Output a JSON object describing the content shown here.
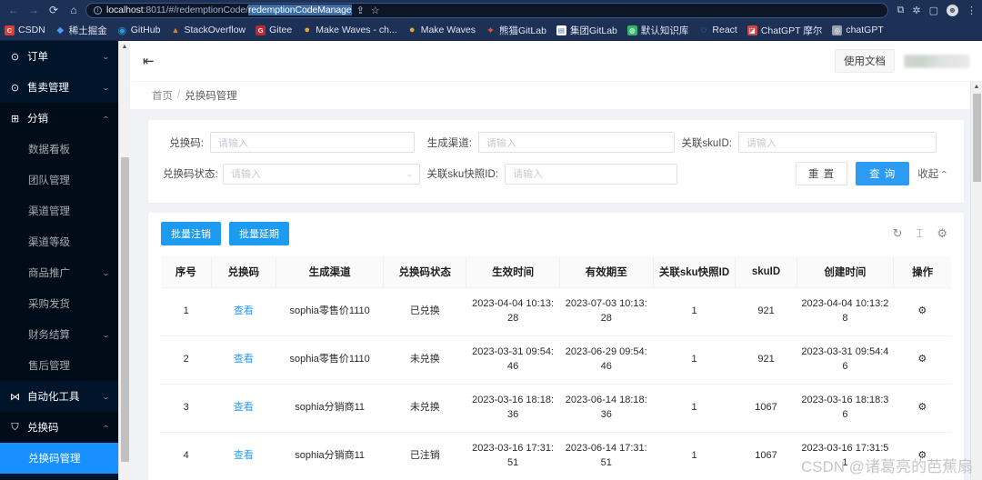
{
  "browser": {
    "nav": {
      "back": "←",
      "forward": "→",
      "reload": "⟳",
      "home": "⌂"
    },
    "url": {
      "scheme_info": "ⓘ",
      "host": "localhost",
      "port": ":8011",
      "path": "/#/redemptionCode/",
      "selected": "redemptionCodeManage"
    },
    "omni_icons": {
      "share": "⇪",
      "star": "☆"
    },
    "toolbar_icons": {
      "tab_group": "⧉",
      "extensions": "✲",
      "sidepanel": "▢",
      "profile": "☻",
      "menu": "⋮"
    },
    "bookmarks": [
      {
        "label": "CSDN",
        "glyph": "C",
        "color": "#e03d2f"
      },
      {
        "label": "稀土掘金",
        "glyph": "◆",
        "color": "#4b9cf6"
      },
      {
        "label": "GitHub",
        "glyph": "◉",
        "color": "#2c9cd6"
      },
      {
        "label": "StackOverflow",
        "glyph": "▲",
        "color": "#e08030"
      },
      {
        "label": "Gitee",
        "glyph": "G",
        "color": "#c6252a"
      },
      {
        "label": "Make Waves - ch...",
        "glyph": "●",
        "color": "#e8a33d"
      },
      {
        "label": "Make Waves",
        "glyph": "●",
        "color": "#e8a33d"
      },
      {
        "label": "熊猫GitLab",
        "glyph": "✦",
        "color": "#e2562a"
      },
      {
        "label": "集团GitLab",
        "glyph": "▤",
        "color": "#ffffff"
      },
      {
        "label": "默认知识库",
        "glyph": "◍",
        "color": "#35b36a"
      },
      {
        "label": "React",
        "glyph": "◌",
        "color": "#35b6c9"
      },
      {
        "label": "ChatGPT 摩尔",
        "glyph": "◪",
        "color": "#c94b4b"
      },
      {
        "label": "chatGPT",
        "glyph": "◎",
        "color": "#9aa3ad"
      }
    ]
  },
  "sidebar": {
    "groups": [
      {
        "icon": "⊙",
        "label": "订单",
        "caret": "⌄",
        "open": false
      },
      {
        "icon": "⊙",
        "label": "售卖管理",
        "caret": "⌄",
        "open": false
      },
      {
        "icon": "⊞",
        "label": "分销",
        "caret": "⌄",
        "open": true,
        "items": [
          {
            "label": "数据看板",
            "caret": "",
            "active": false
          },
          {
            "label": "团队管理",
            "caret": "",
            "active": false
          },
          {
            "label": "渠道管理",
            "caret": "",
            "active": false
          },
          {
            "label": "渠道等级",
            "caret": "",
            "active": false
          },
          {
            "label": "商品推广",
            "caret": "⌄",
            "active": false
          },
          {
            "label": "采购发货",
            "caret": "",
            "active": false
          },
          {
            "label": "财务结算",
            "caret": "⌄",
            "active": false
          },
          {
            "label": "售后管理",
            "caret": "",
            "active": false
          }
        ]
      },
      {
        "icon": "⋈",
        "label": "自动化工具",
        "caret": "⌄",
        "open": false
      },
      {
        "icon": "⛉",
        "label": "兑换码",
        "caret": "⌄",
        "open": true,
        "items": [
          {
            "label": "兑换码管理",
            "caret": "",
            "active": true
          }
        ]
      }
    ]
  },
  "appbar": {
    "menu_toggle": "⇤",
    "doc_button": "使用文档"
  },
  "breadcrumb": {
    "home": "首页",
    "separator": "/",
    "current": "兑换码管理"
  },
  "search_form": {
    "fields": [
      {
        "label": "兑换码:",
        "placeholder": "请输入",
        "value": "",
        "type": "input"
      },
      {
        "label": "生成渠道:",
        "placeholder": "请输入",
        "value": "",
        "type": "input"
      },
      {
        "label": "关联skuID:",
        "placeholder": "请输入",
        "value": "",
        "type": "input"
      },
      {
        "label": "兑换码状态:",
        "placeholder": "请输入",
        "value": "",
        "type": "select"
      },
      {
        "label": "关联sku快照ID:",
        "placeholder": "请输入",
        "value": "",
        "type": "input"
      }
    ],
    "reset_label": "重 置",
    "query_label": "查 询",
    "collapse_label": "收起",
    "collapse_caret": "⌃"
  },
  "table_toolbar": {
    "batch_cancel": "批量注销",
    "batch_extend": "批量延期",
    "icons": {
      "refresh": "↻",
      "density": "⌶",
      "settings": "⚙"
    }
  },
  "table": {
    "columns": [
      "序号",
      "兑换码",
      "生成渠道",
      "兑换码状态",
      "生效时间",
      "有效期至",
      "关联sku快照ID",
      "skuID",
      "创建时间",
      "操作"
    ],
    "rows": [
      {
        "index": "1",
        "code_link": "查看",
        "channel": "sophia零售价1110",
        "status": "已兑换",
        "effective": "2023-04-04 10:13:28",
        "expires": "2023-07-03 10:13:28",
        "snapshot_id": "1",
        "sku_id": "921",
        "created": "2023-04-04 10:13:28",
        "op_icon": "⚙"
      },
      {
        "index": "2",
        "code_link": "查看",
        "channel": "sophia零售价1110",
        "status": "未兑换",
        "effective": "2023-03-31 09:54:46",
        "expires": "2023-06-29 09:54:46",
        "snapshot_id": "1",
        "sku_id": "921",
        "created": "2023-03-31 09:54:46",
        "op_icon": "⚙"
      },
      {
        "index": "3",
        "code_link": "查看",
        "channel": "sophia分销商11",
        "status": "未兑换",
        "effective": "2023-03-16 18:18:36",
        "expires": "2023-06-14 18:18:36",
        "snapshot_id": "1",
        "sku_id": "1067",
        "created": "2023-03-16 18:18:36",
        "op_icon": "⚙"
      },
      {
        "index": "4",
        "code_link": "查看",
        "channel": "sophia分销商11",
        "status": "已注销",
        "effective": "2023-03-16 17:31:51",
        "expires": "2023-06-14 17:31:51",
        "snapshot_id": "1",
        "sku_id": "1067",
        "created": "2023-03-16 17:31:51",
        "op_icon": "⚙"
      }
    ]
  },
  "watermark": "CSDN @诸葛亮的芭蕉扇",
  "colors": {
    "primary": "#1890ff",
    "sidebar_bg": "#001529",
    "link": "#2b9bf4",
    "query_btn": "#2b9bf4"
  }
}
